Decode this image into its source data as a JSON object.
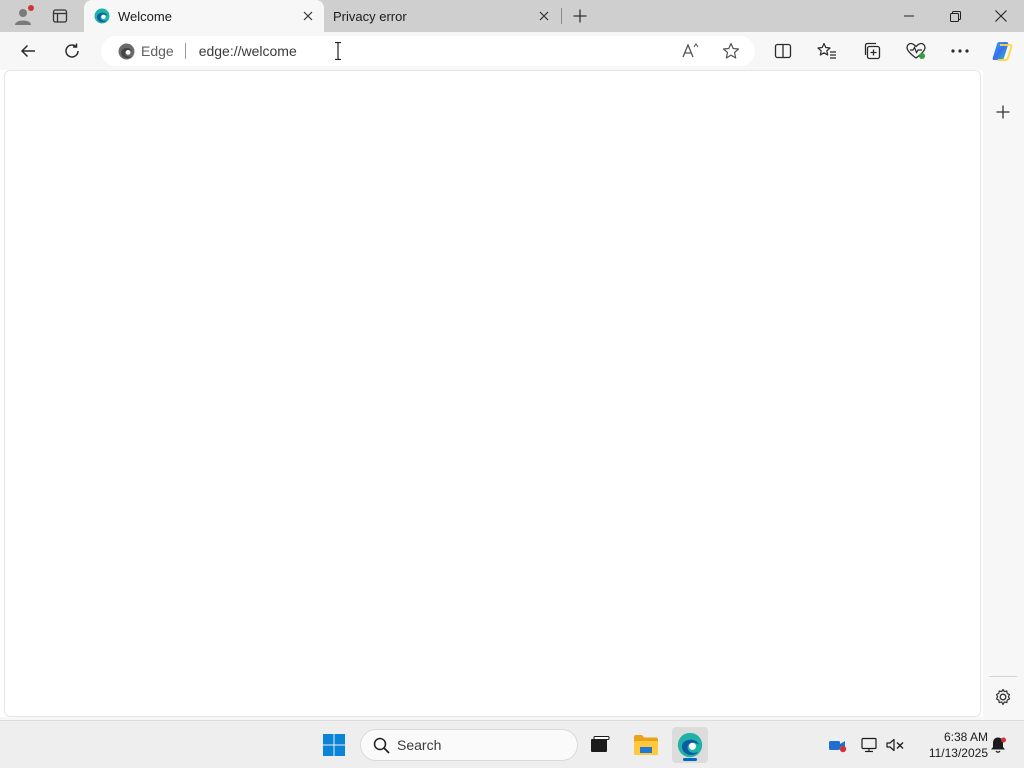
{
  "browser": {
    "tabs": [
      {
        "title": "Welcome",
        "active": true,
        "favicon": "edge-icon"
      },
      {
        "title": "Privacy error",
        "active": false,
        "favicon": "none"
      }
    ],
    "address_bar": {
      "site_label": "Edge",
      "url": "edge://welcome"
    },
    "toolbar_icons": [
      "back-icon",
      "refresh-icon",
      "read-aloud-icon",
      "favorite-star-icon",
      "split-screen-icon",
      "favorites-icon",
      "collections-icon",
      "browser-essentials-icon",
      "more-icon",
      "copilot-icon"
    ],
    "sidebar_icons": [
      "add-icon",
      "settings-icon"
    ]
  },
  "taskbar": {
    "search_placeholder": "Search",
    "clock": {
      "time": "6:38 AM",
      "date": "11/13/2025"
    },
    "pinned": [
      "start-icon",
      "search-icon",
      "task-view-icon",
      "file-explorer-icon",
      "edge-icon"
    ],
    "tray_icons": [
      "meet-now-icon",
      "network-icon",
      "volume-muted-icon",
      "notification-icon"
    ]
  },
  "colors": {
    "titlebar": "#cfcfcf",
    "toolbar": "#f7f7f7",
    "accent": "#0067c0",
    "edge_teal": "#1fb2a8"
  }
}
